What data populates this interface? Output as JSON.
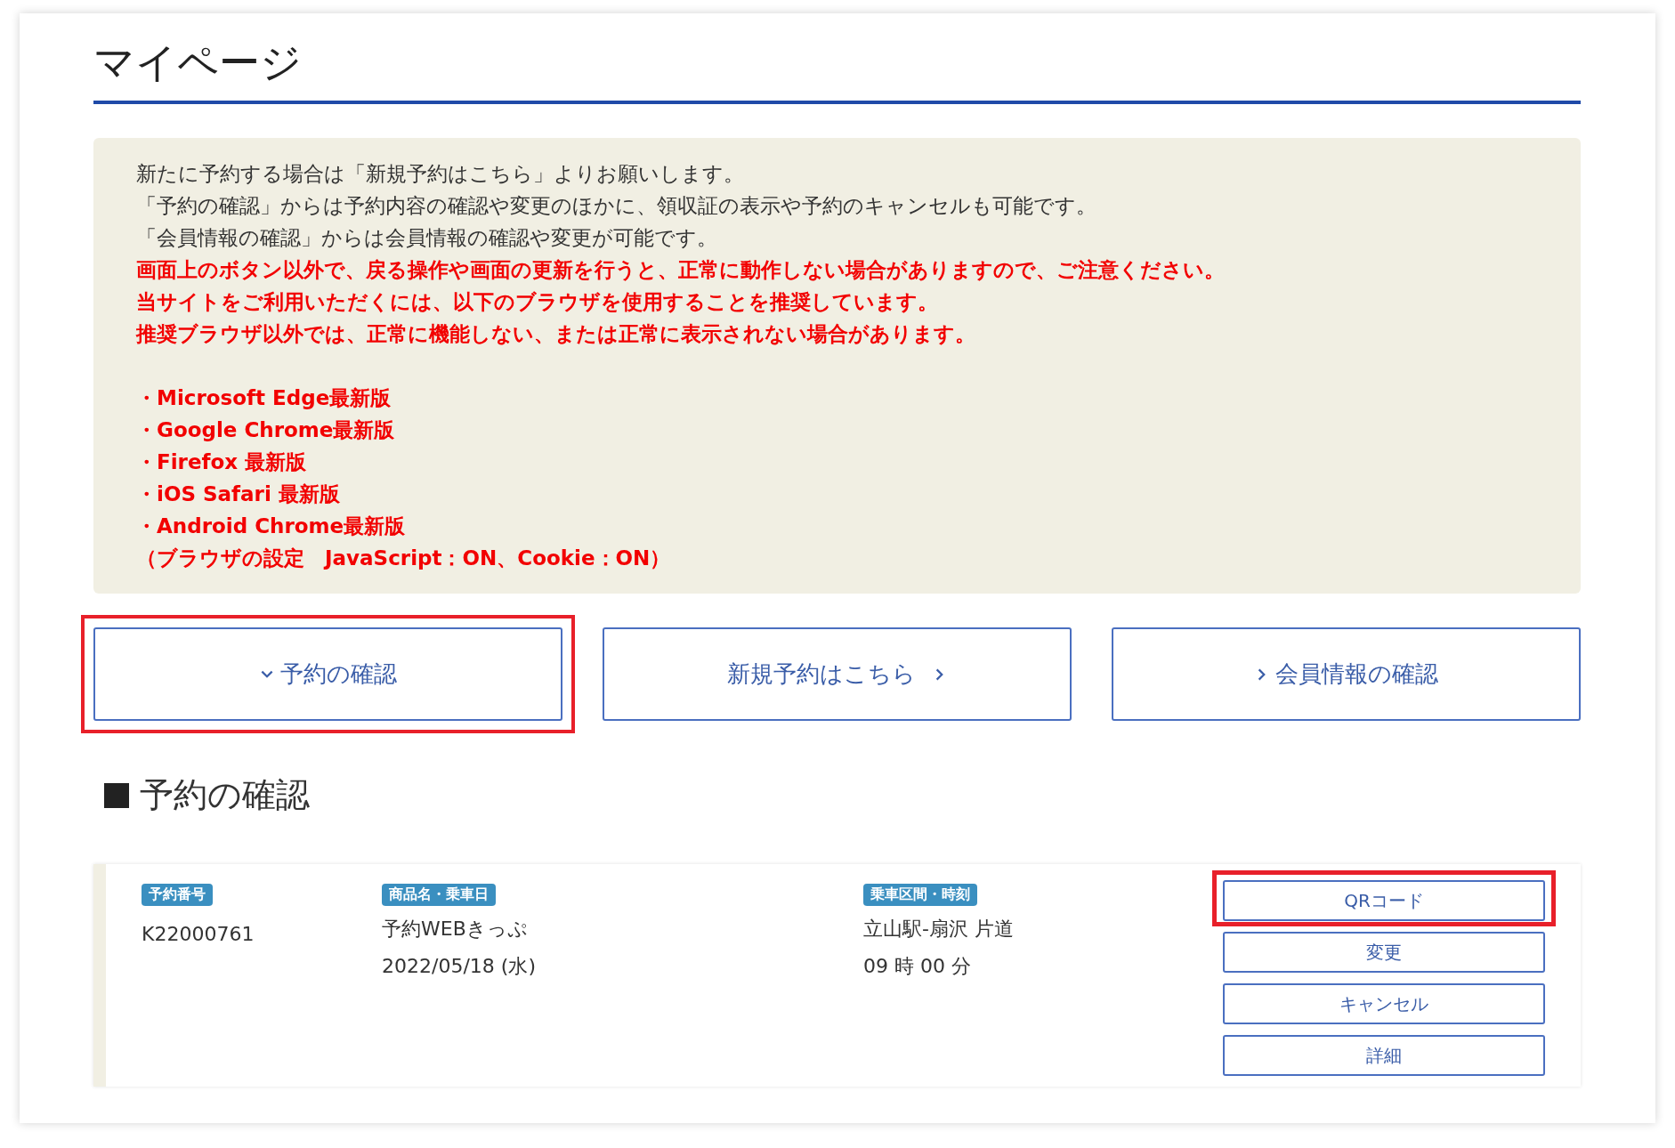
{
  "page": {
    "title": "マイページ"
  },
  "notice": {
    "lines": [
      {
        "text": "新たに予約する場合は「新規予約はこちら」よりお願いします。",
        "kind": "normal"
      },
      {
        "text": "「予約の確認」からは予約内容の確認や変更のほかに、領収証の表示や予約のキャンセルも可能です。",
        "kind": "normal"
      },
      {
        "text": "「会員情報の確認」からは会員情報の確認や変更が可能です。",
        "kind": "normal"
      },
      {
        "text": "画面上のボタン以外で、戻る操作や画面の更新を行うと、正常に動作しない場合がありますので、ご注意ください。",
        "kind": "warning"
      },
      {
        "text": "当サイトをご利用いただくには、以下のブラウザを使用することを推奨しています。",
        "kind": "warning"
      },
      {
        "text": "推奨ブラウザ以外では、正常に機能しない、または正常に表示されない場合があります。",
        "kind": "warning"
      }
    ],
    "browsers": [
      {
        "text": "・Microsoft Edge最新版"
      },
      {
        "text": "・Google Chrome最新版"
      },
      {
        "text": "・Firefox 最新版"
      },
      {
        "text": "・iOS Safari 最新版"
      },
      {
        "text": "・Android Chrome最新版"
      },
      {
        "text": "（ブラウザの設定　JavaScript：ON、Cookie：ON）"
      }
    ]
  },
  "nav_buttons": [
    {
      "label": "予約の確認",
      "kind": "expand",
      "highlighted": true
    },
    {
      "label": "新規予約はこちら",
      "kind": "next",
      "highlighted": false
    },
    {
      "label": "会員情報の確認",
      "kind": "go",
      "highlighted": false
    }
  ],
  "section": {
    "title": "予約の確認"
  },
  "reservations": [
    {
      "fields": [
        {
          "label": "予約番号",
          "values": [
            "K22000761"
          ]
        },
        {
          "label": "商品名・乗車日",
          "values": [
            "予約WEBきっぷ",
            "2022/05/18 (水)"
          ]
        },
        {
          "label": "乗車区間・時刻",
          "values": [
            "立山駅-扇沢 片道",
            "09 時 00 分"
          ]
        }
      ],
      "actions": [
        {
          "label": "QRコード",
          "highlighted": true
        },
        {
          "label": "変更",
          "highlighted": false
        },
        {
          "label": "キャンセル",
          "highlighted": false
        },
        {
          "label": "詳細",
          "highlighted": false
        }
      ]
    }
  ]
}
